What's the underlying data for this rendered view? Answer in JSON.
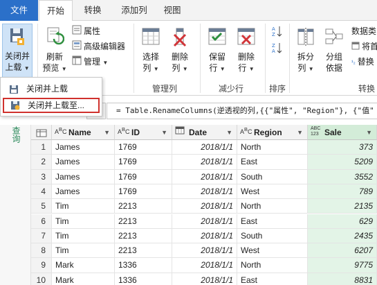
{
  "tabs": {
    "file": "文件",
    "home": "开始",
    "transform": "转换",
    "addColumn": "添加列",
    "view": "视图"
  },
  "ribbon": {
    "closeLoad": {
      "line1": "关闭并",
      "line2": "上载"
    },
    "refresh": {
      "line1": "刷新",
      "line2": "预览"
    },
    "properties": "属性",
    "advancedEditor": "高级编辑器",
    "manage": "管理",
    "chooseColumns": {
      "line1": "选择",
      "line2": "列"
    },
    "removeColumns": {
      "line1": "删除",
      "line2": "列"
    },
    "keepRows": {
      "line1": "保留",
      "line2": "行"
    },
    "removeRows": {
      "line1": "删除",
      "line2": "行"
    },
    "split": {
      "line1": "拆分",
      "line2": "列"
    },
    "groupBy": {
      "line1": "分组",
      "line2": "依据"
    },
    "dataType": "数据类",
    "firstRow": "将首",
    "replace": "替换",
    "groups": {
      "manageColumns": "管理列",
      "reduceRows": "减少行",
      "sort": "排序",
      "transform": "转换"
    }
  },
  "menu": {
    "item1": "关闭并上载",
    "item2": "关闭并上载至..."
  },
  "formula": "= Table.RenameColumns(逆透视的列,{{\"属性\", \"Region\"}, {\"值\"",
  "queriesLabel": "查询",
  "columns": [
    {
      "name": "Name",
      "typeIcon": "ABC"
    },
    {
      "name": "ID",
      "typeIcon": "ABC"
    },
    {
      "name": "Date",
      "typeIcon": "calendar"
    },
    {
      "name": "Region",
      "typeIcon": "ABC"
    },
    {
      "name": "Sale",
      "typeIcon": "ABC123"
    }
  ],
  "rows": [
    {
      "n": "1",
      "name": "James",
      "id": "1769",
      "date": "2018/1/1",
      "region": "North",
      "sale": "373"
    },
    {
      "n": "2",
      "name": "James",
      "id": "1769",
      "date": "2018/1/1",
      "region": "East",
      "sale": "5209"
    },
    {
      "n": "3",
      "name": "James",
      "id": "1769",
      "date": "2018/1/1",
      "region": "South",
      "sale": "3552"
    },
    {
      "n": "4",
      "name": "James",
      "id": "1769",
      "date": "2018/1/1",
      "region": "West",
      "sale": "789"
    },
    {
      "n": "5",
      "name": "Tim",
      "id": "2213",
      "date": "2018/1/1",
      "region": "North",
      "sale": "2135"
    },
    {
      "n": "6",
      "name": "Tim",
      "id": "2213",
      "date": "2018/1/1",
      "region": "East",
      "sale": "629"
    },
    {
      "n": "7",
      "name": "Tim",
      "id": "2213",
      "date": "2018/1/1",
      "region": "South",
      "sale": "2435"
    },
    {
      "n": "8",
      "name": "Tim",
      "id": "2213",
      "date": "2018/1/1",
      "region": "West",
      "sale": "6207"
    },
    {
      "n": "9",
      "name": "Mark",
      "id": "1336",
      "date": "2018/1/1",
      "region": "North",
      "sale": "9775"
    },
    {
      "n": "10",
      "name": "Mark",
      "id": "1336",
      "date": "2018/1/1",
      "region": "East",
      "sale": "8831"
    }
  ]
}
